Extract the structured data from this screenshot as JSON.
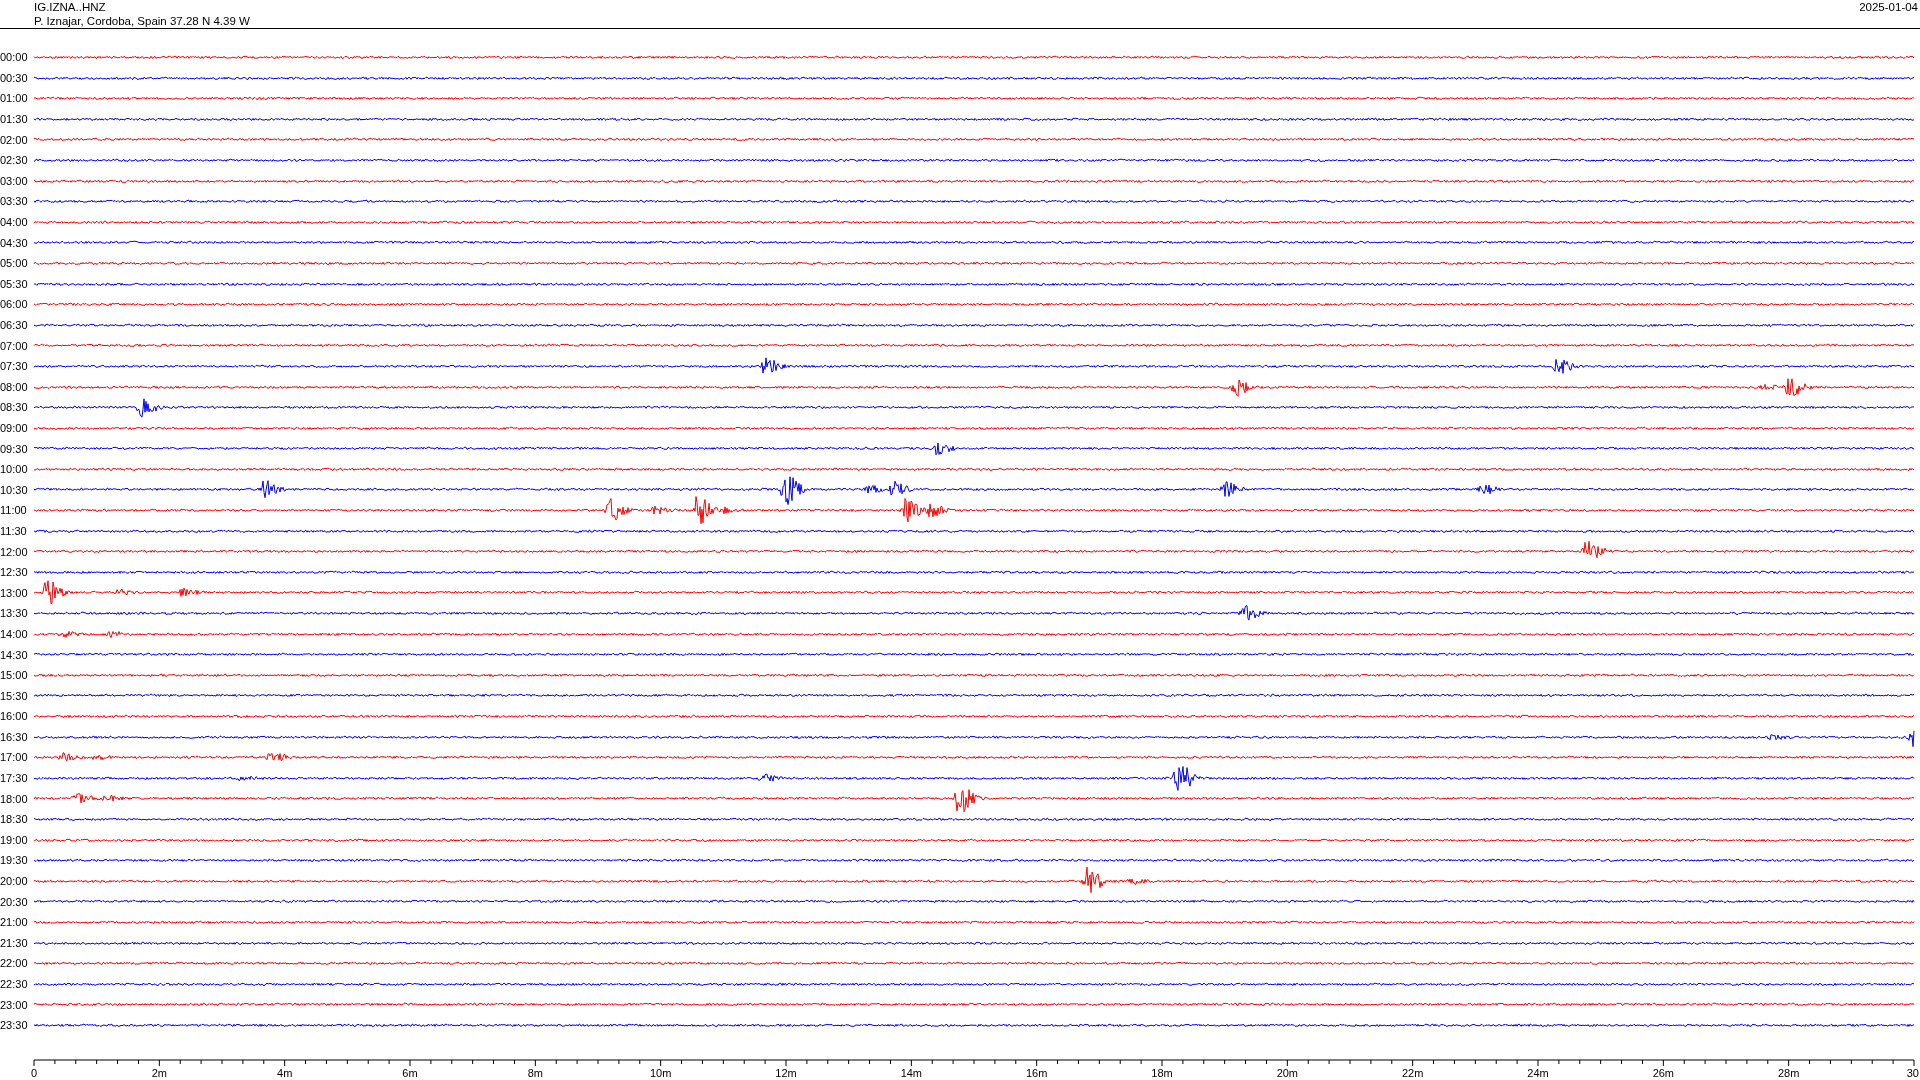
{
  "header": {
    "station": "IG.IZNA..HNZ",
    "location": "P. Iznajar, Cordoba, Spain  37.28 N 4.39 W",
    "date": "2025-01-04"
  },
  "rows": [
    {
      "time": "00:00",
      "color": "#ff0000"
    },
    {
      "time": "00:30",
      "color": "#0000ff"
    },
    {
      "time": "01:00",
      "color": "#ff0000"
    },
    {
      "time": "01:30",
      "color": "#0000ff"
    },
    {
      "time": "02:00",
      "color": "#ff0000"
    },
    {
      "time": "02:30",
      "color": "#0000ff"
    },
    {
      "time": "03:00",
      "color": "#ff0000"
    },
    {
      "time": "03:30",
      "color": "#0000ff"
    },
    {
      "time": "04:00",
      "color": "#ff0000"
    },
    {
      "time": "04:30",
      "color": "#0000ff"
    },
    {
      "time": "05:00",
      "color": "#ff0000"
    },
    {
      "time": "05:30",
      "color": "#0000ff"
    },
    {
      "time": "06:00",
      "color": "#ff0000"
    },
    {
      "time": "06:30",
      "color": "#0000ff"
    },
    {
      "time": "07:00",
      "color": "#ff0000"
    },
    {
      "time": "07:30",
      "color": "#0000ff"
    },
    {
      "time": "08:00",
      "color": "#ff0000"
    },
    {
      "time": "08:30",
      "color": "#0000ff"
    },
    {
      "time": "09:00",
      "color": "#ff0000"
    },
    {
      "time": "09:30",
      "color": "#0000ff"
    },
    {
      "time": "10:00",
      "color": "#ff0000"
    },
    {
      "time": "10:30",
      "color": "#0000ff"
    },
    {
      "time": "11:00",
      "color": "#ff0000"
    },
    {
      "time": "11:30",
      "color": "#0000ff"
    },
    {
      "time": "12:00",
      "color": "#ff0000"
    },
    {
      "time": "12:30",
      "color": "#0000ff"
    },
    {
      "time": "13:00",
      "color": "#ff0000"
    },
    {
      "time": "13:30",
      "color": "#0000ff"
    },
    {
      "time": "14:00",
      "color": "#ff0000"
    },
    {
      "time": "14:30",
      "color": "#0000ff"
    },
    {
      "time": "15:00",
      "color": "#ff0000"
    },
    {
      "time": "15:30",
      "color": "#0000ff"
    },
    {
      "time": "16:00",
      "color": "#ff0000"
    },
    {
      "time": "16:30",
      "color": "#0000ff"
    },
    {
      "time": "17:00",
      "color": "#ff0000"
    },
    {
      "time": "17:30",
      "color": "#0000ff"
    },
    {
      "time": "18:00",
      "color": "#ff0000"
    },
    {
      "time": "18:30",
      "color": "#0000ff"
    },
    {
      "time": "19:00",
      "color": "#ff0000"
    },
    {
      "time": "19:30",
      "color": "#0000ff"
    },
    {
      "time": "20:00",
      "color": "#ff0000"
    },
    {
      "time": "20:30",
      "color": "#0000ff"
    },
    {
      "time": "21:00",
      "color": "#ff0000"
    },
    {
      "time": "21:30",
      "color": "#0000ff"
    },
    {
      "time": "22:00",
      "color": "#ff0000"
    },
    {
      "time": "22:30",
      "color": "#0000ff"
    },
    {
      "time": "23:00",
      "color": "#ff0000"
    },
    {
      "time": "23:30",
      "color": "#0000ff"
    }
  ],
  "x_axis": {
    "labels": [
      "0",
      "2m",
      "4m",
      "6m",
      "8m",
      "10m",
      "12m",
      "14m",
      "16m",
      "18m",
      "20m",
      "22m",
      "24m",
      "26m",
      "28m",
      "30"
    ]
  }
}
